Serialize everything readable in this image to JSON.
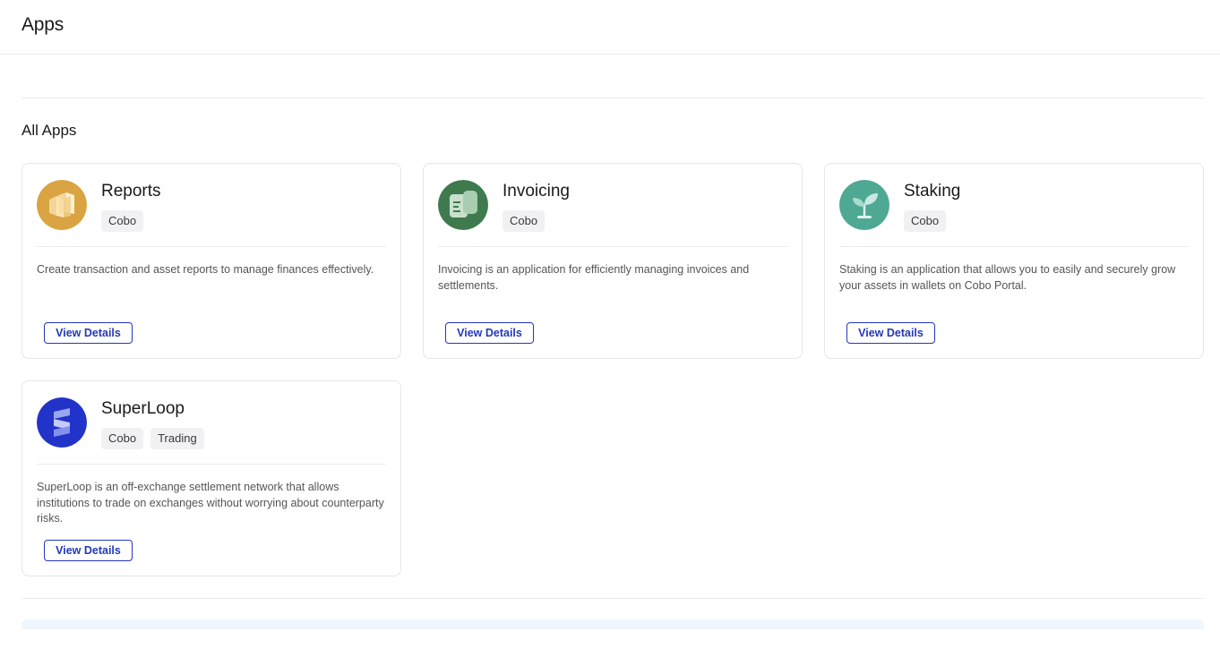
{
  "page": {
    "title": "Apps"
  },
  "section": {
    "title": "All Apps"
  },
  "colors": {
    "accent": "#2438b8",
    "reports": "#d9a441",
    "invoicing": "#3f7a4f",
    "staking": "#4fa894",
    "superloop": "#2233c9"
  },
  "apps": [
    {
      "name": "Reports",
      "icon": "reports-boxes-icon",
      "tags": [
        "Cobo"
      ],
      "description": "Create transaction and asset reports to manage finances effectively.",
      "button_label": "View Details"
    },
    {
      "name": "Invoicing",
      "icon": "invoice-scroll-icon",
      "tags": [
        "Cobo"
      ],
      "description": "Invoicing is an application for efficiently managing invoices and settlements.",
      "button_label": "View Details"
    },
    {
      "name": "Staking",
      "icon": "sprout-icon",
      "tags": [
        "Cobo"
      ],
      "description": "Staking is an application that allows you to easily and securely grow your assets in wallets on Cobo Portal.",
      "button_label": "View Details"
    },
    {
      "name": "SuperLoop",
      "icon": "superloop-logo-icon",
      "tags": [
        "Cobo",
        "Trading"
      ],
      "description": "SuperLoop is an off-exchange settlement network that allows institutions to trade on exchanges without worrying about counterparty risks.",
      "button_label": "View Details"
    }
  ]
}
